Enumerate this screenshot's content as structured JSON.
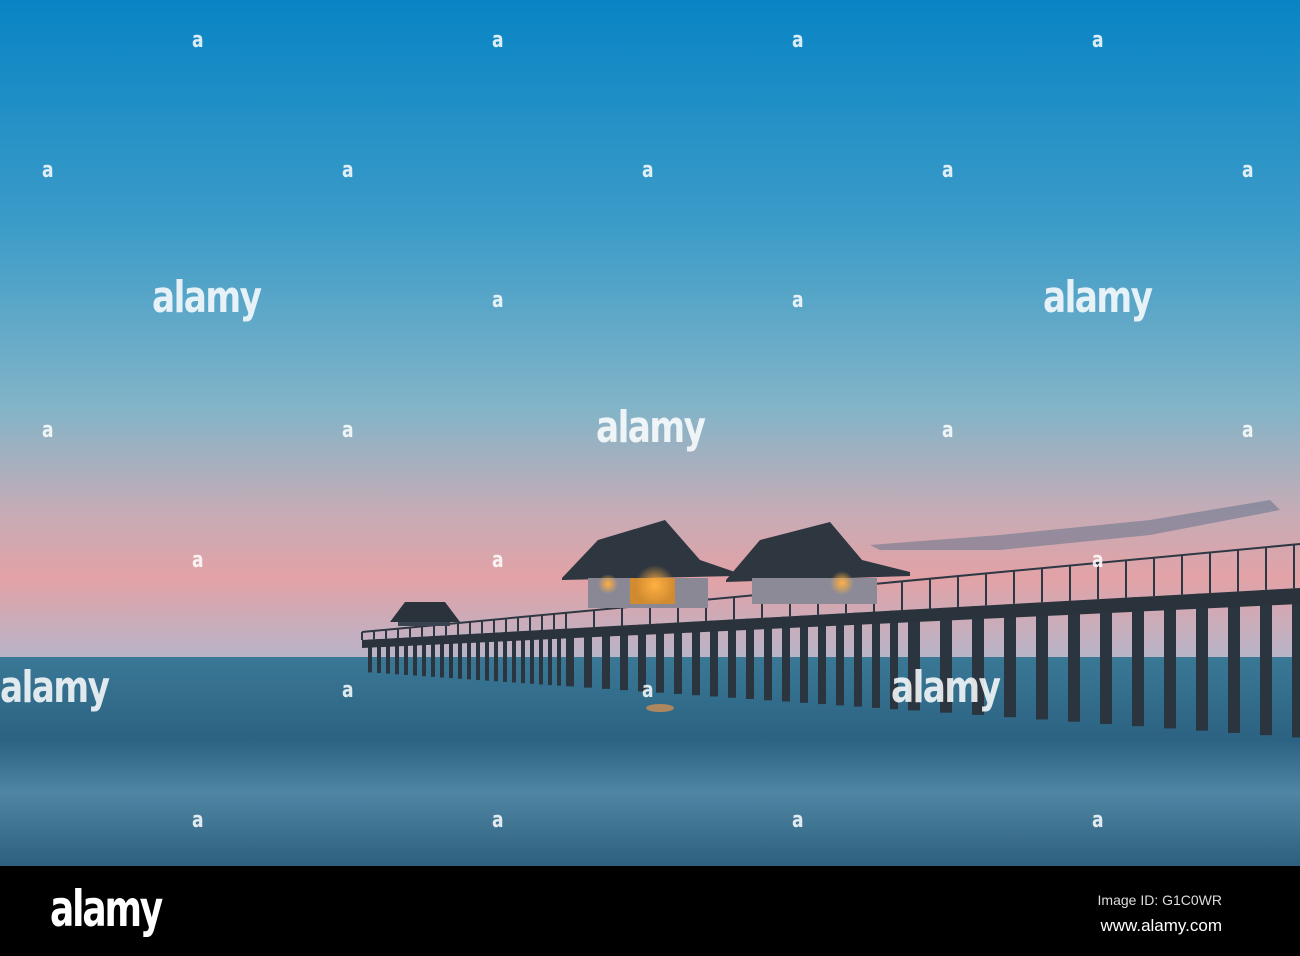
{
  "watermark": {
    "logo_text": "alamy",
    "mark_glyph": "a"
  },
  "footer": {
    "logo": "alamy",
    "image_id": "Image ID: G1C0WR",
    "url": "www.alamy.com"
  },
  "colors": {
    "sky_top": "#0884c4",
    "sky_mid": "#5aa6c6",
    "sky_glow": "#e0a4a8",
    "sea": "#2f6684",
    "footer_bg": "#000000"
  }
}
